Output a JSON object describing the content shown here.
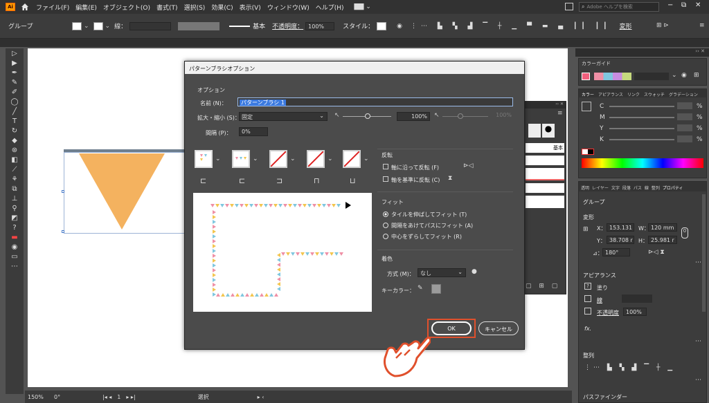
{
  "menubar": {
    "logo": "Ai",
    "items": [
      "ファイル(F)",
      "編集(E)",
      "オブジェクト(O)",
      "書式(T)",
      "選択(S)",
      "効果(C)",
      "表示(V)",
      "ウィンドウ(W)",
      "ヘルプ(H)"
    ],
    "search_placeholder": "Adobe ヘルプを検索"
  },
  "controlbar": {
    "group_label": "グループ",
    "line_label": "線：",
    "stroke_style": "基本",
    "opacity_label": "不透明度：",
    "opacity_value": "100%",
    "style_label": "スタイル：",
    "transform_label": "変形"
  },
  "status": {
    "zoom": "150%",
    "angle": "0°",
    "page": "1",
    "mode": "選択"
  },
  "dialog": {
    "title": "パターンブラシオプション",
    "options_heading": "オプション",
    "name_label": "名前 (N)：",
    "name_value": "パターンブラシ 1",
    "scale_label": "拡大・縮小 (S)：",
    "scale_mode": "固定",
    "scale_value": "100%",
    "scale_max": "100%",
    "spacing_label": "間隔 (P)：",
    "spacing_value": "0%",
    "flip_heading": "反転",
    "flip_along": "軸に沿って反転 (F)",
    "flip_across": "軸を基準に反転 (C)",
    "fit_heading": "フィット",
    "fit_options": [
      "タイルを伸ばしてフィット (T)",
      "間隔をあけてパスにフィット (A)",
      "中心をずらしてフィット (R)"
    ],
    "fit_selected": 0,
    "color_heading": "着色",
    "method_label": "方式 (M)：",
    "method_value": "なし",
    "keycolor_label": "キーカラー：",
    "ok_label": "OK",
    "cancel_label": "キャンセル"
  },
  "colorguide": {
    "title": "カラーガイド"
  },
  "color": {
    "tabs": [
      "カラー",
      "アピアランス",
      "リンク",
      "スウォッチ",
      "グラデーション"
    ],
    "channels": [
      {
        "name": "C",
        "unit": "%"
      },
      {
        "name": "M",
        "unit": "%"
      },
      {
        "name": "Y",
        "unit": "%"
      },
      {
        "name": "K",
        "unit": "%"
      }
    ]
  },
  "properties": {
    "tabs": [
      "透明",
      "レイヤー",
      "文字",
      "段落",
      "パス",
      "線",
      "整列",
      "プロパティ"
    ],
    "group": "グループ",
    "transform_heading": "変形",
    "x_label": "X：",
    "x_value": "153.131",
    "w_label": "W：",
    "w_value": "120 mm",
    "y_label": "Y：",
    "y_value": "38.708 r",
    "h_label": "H：",
    "h_value": "25.981 r",
    "angle_label": "⊿：",
    "angle_value": "180°",
    "appearance_heading": "アピアランス",
    "fill_label": "塗り",
    "stroke_label": "線",
    "opacity_label": "不透明度",
    "opacity_value": "100%",
    "fx_label": "fx.",
    "align_heading": "整列",
    "pathfinder_label": "パスファインダー"
  },
  "brushes": {
    "basic_label": "基本"
  },
  "colors": {
    "triangle": "#f4b25f",
    "tri_pink": "#ef8fa5",
    "tri_yellow": "#f3c54e",
    "tri_blue": "#7fc7df",
    "ok_border": "#e0502c"
  }
}
